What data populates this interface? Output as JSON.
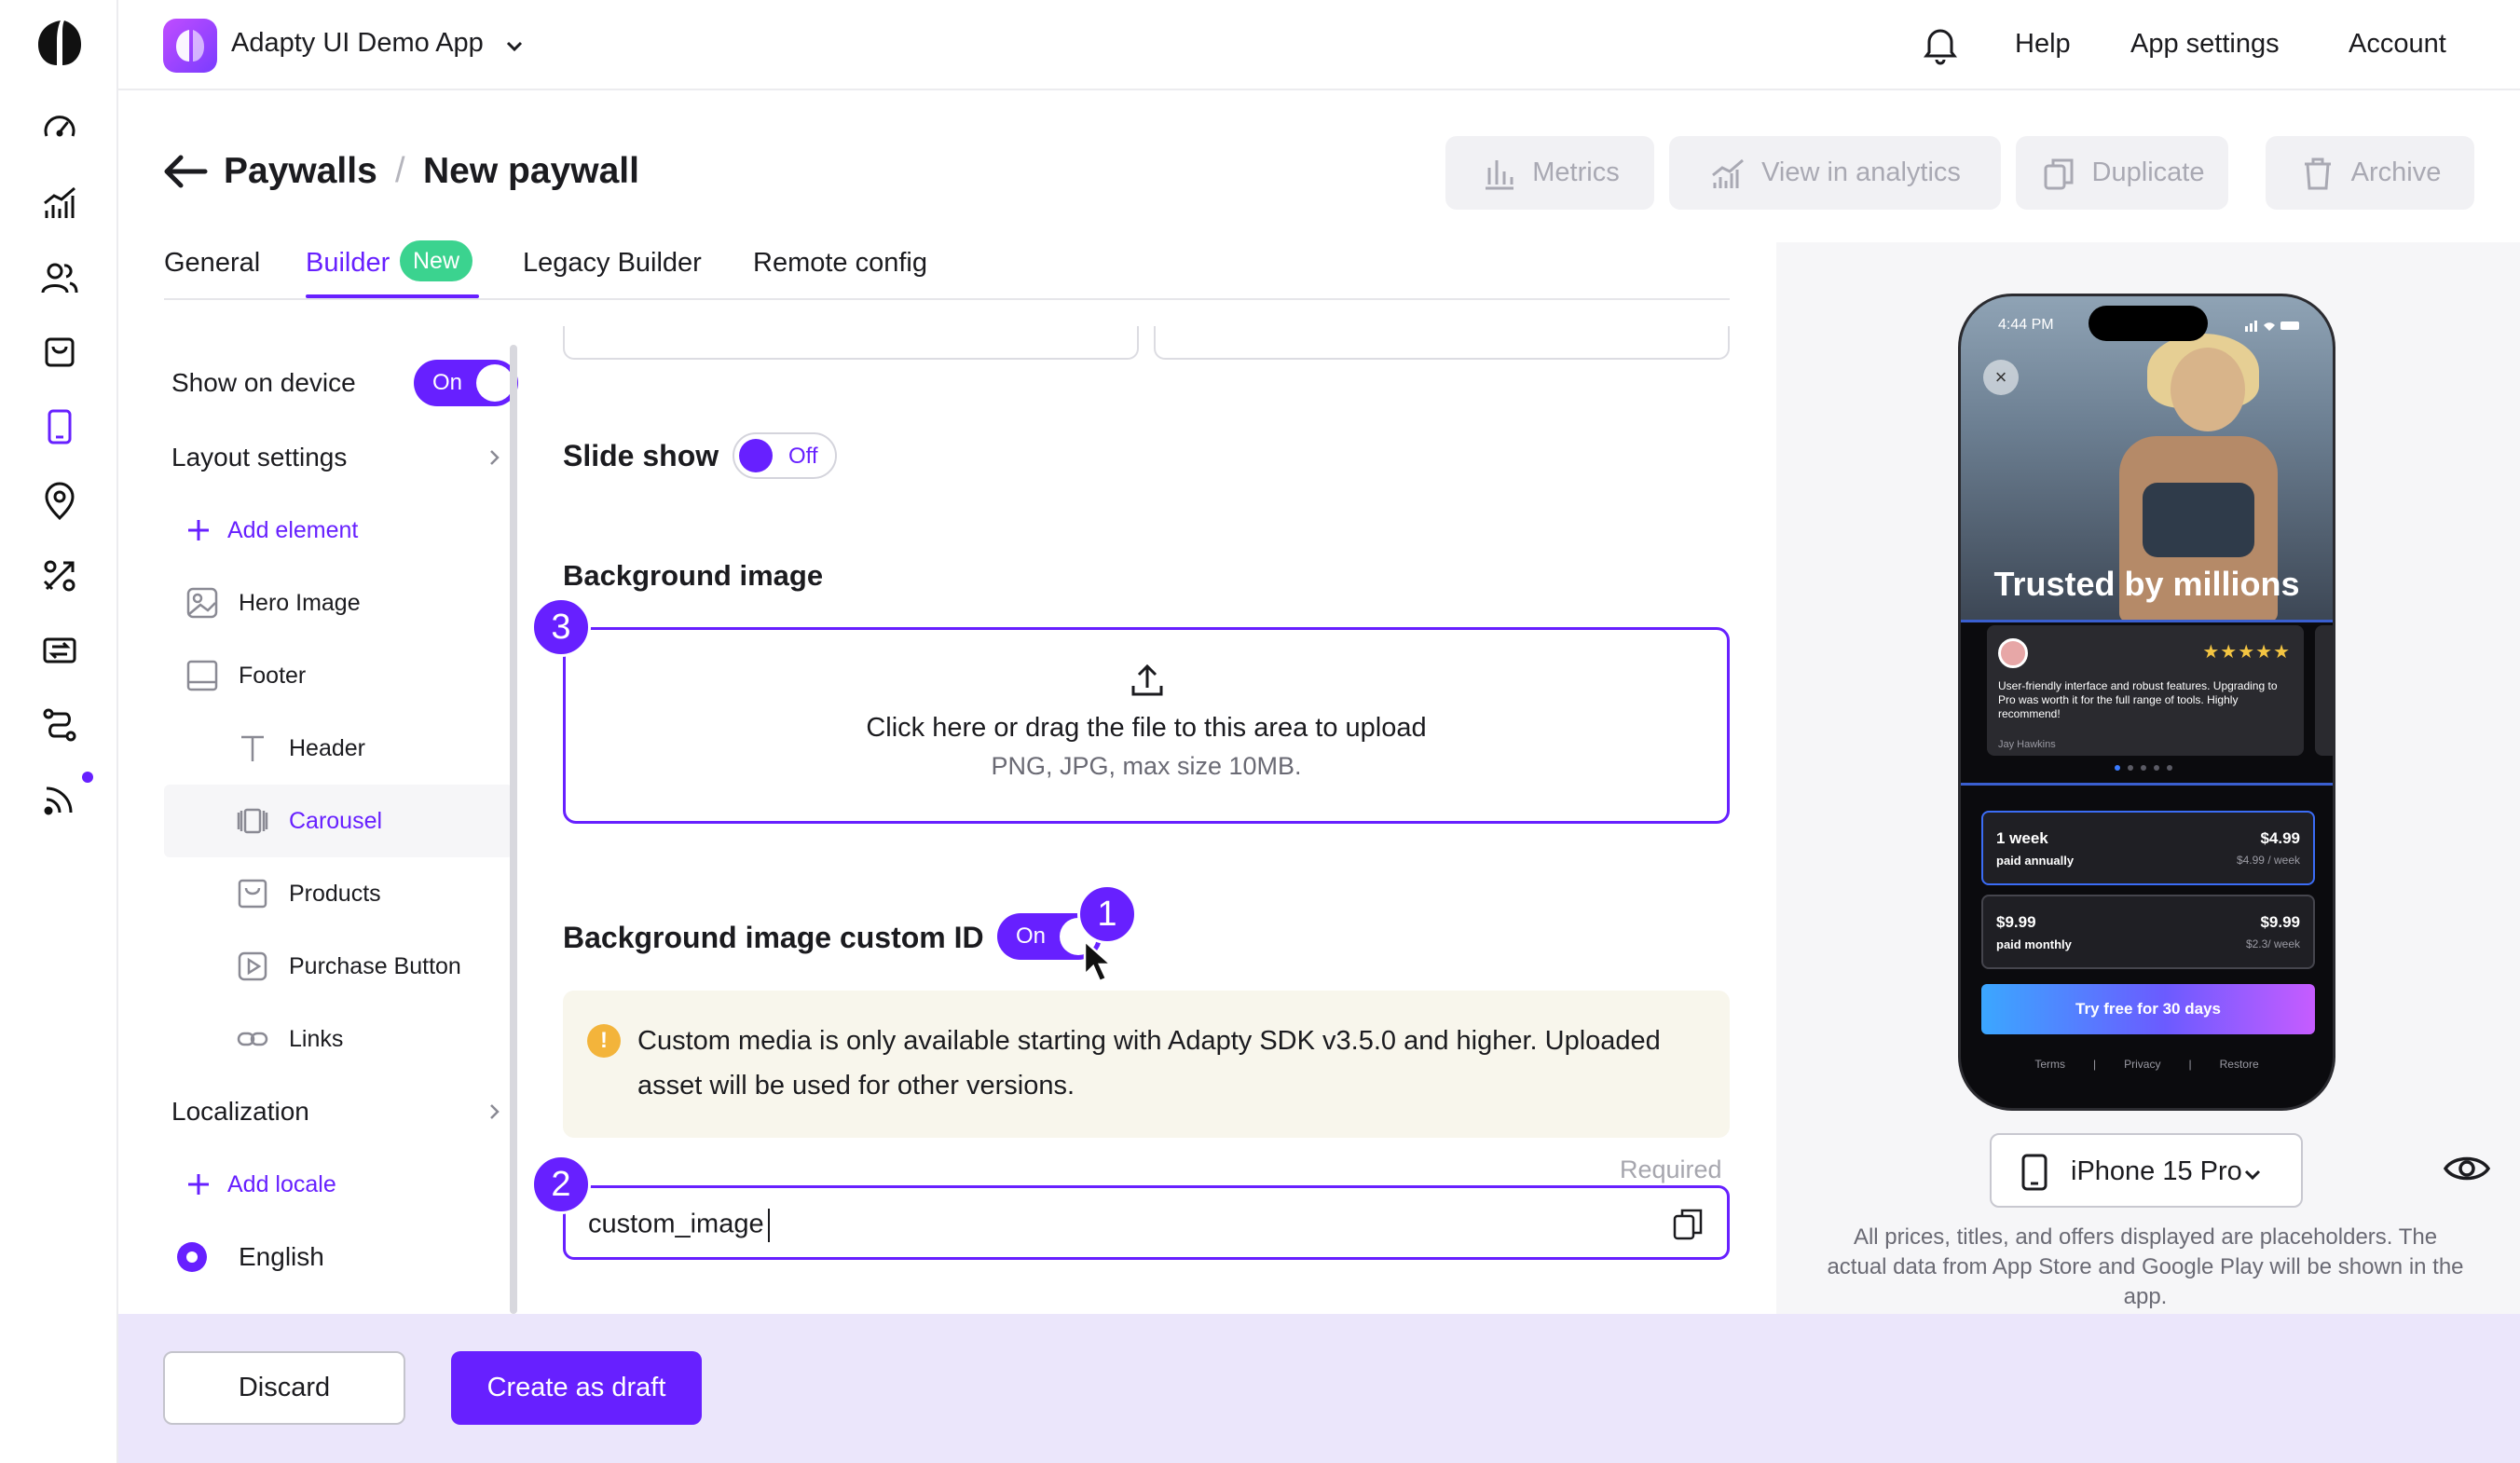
{
  "app": {
    "name": "Adapty UI Demo App"
  },
  "top_nav": {
    "help": "Help",
    "app_settings": "App settings",
    "account": "Account"
  },
  "breadcrumb": {
    "root": "Paywalls",
    "separator": "/",
    "current": "New paywall"
  },
  "header_actions": {
    "metrics": "Metrics",
    "view_in_analytics": "View in analytics",
    "duplicate": "Duplicate",
    "archive": "Archive"
  },
  "tabs": [
    {
      "label": "General"
    },
    {
      "label": "Builder",
      "badge": "New",
      "active": true
    },
    {
      "label": "Legacy Builder"
    },
    {
      "label": "Remote config"
    }
  ],
  "tree": {
    "show_on_device": {
      "label": "Show on device",
      "toggle": "On"
    },
    "layout_settings": "Layout settings",
    "add_element": "Add element",
    "elements": [
      {
        "label": "Hero Image",
        "icon": "image-icon"
      },
      {
        "label": "Footer",
        "icon": "footer-icon"
      },
      {
        "label": "Header",
        "icon": "text-icon"
      },
      {
        "label": "Carousel",
        "icon": "carousel-icon",
        "selected": true
      },
      {
        "label": "Products",
        "icon": "bag-icon"
      },
      {
        "label": "Purchase Button",
        "icon": "play-icon"
      },
      {
        "label": "Links",
        "icon": "link-icon"
      }
    ],
    "localization": "Localization",
    "add_locale": "Add locale",
    "locales": [
      {
        "label": "English",
        "selected": true
      }
    ]
  },
  "settings": {
    "slide_show": {
      "label": "Slide show",
      "toggle": "Off"
    },
    "background_image": {
      "label": "Background image",
      "upload_main": "Click here or drag the file to this area to upload",
      "upload_sub": "PNG, JPG, max size 10MB."
    },
    "custom_id": {
      "label": "Background image custom ID",
      "toggle": "On",
      "notice": "Custom media is only available starting with Adapty SDK v3.5.0 and higher. Uploaded asset will be used for other versions.",
      "required": "Required",
      "value": "custom_image"
    },
    "steps": {
      "one": "1",
      "two": "2",
      "three": "3"
    }
  },
  "preview": {
    "phone": {
      "time": "4:44 PM",
      "headline": "Trusted by millions",
      "review": {
        "stars": "★★★★★",
        "text": "User-friendly interface and robust features. Upgrading to Pro was worth it for the full range of tools. Highly recommend!",
        "author": "Jay Hawkins"
      },
      "products": [
        {
          "name": "1 week",
          "sub": "paid annually",
          "price": "$4.99",
          "per": "$4.99 / week",
          "selected": true
        },
        {
          "name": "$9.99",
          "sub": "paid monthly",
          "price": "$9.99",
          "per": "$2.3/ week"
        }
      ],
      "cta": "Try free for 30 days",
      "legal": {
        "terms": "Terms",
        "sep": "|",
        "privacy": "Privacy",
        "restore": "Restore"
      }
    },
    "device": "iPhone 15 Pro",
    "disclaimer": "All prices, titles, and offers displayed are placeholders. The actual data from App Store and Google Play will be shown in the app."
  },
  "footer": {
    "discard": "Discard",
    "create_draft": "Create as draft"
  },
  "colors": {
    "accent": "#6720ff",
    "badge": "#3bd38f",
    "warning": "#f3b43b",
    "bottom_bar": "#ebe6fb"
  }
}
